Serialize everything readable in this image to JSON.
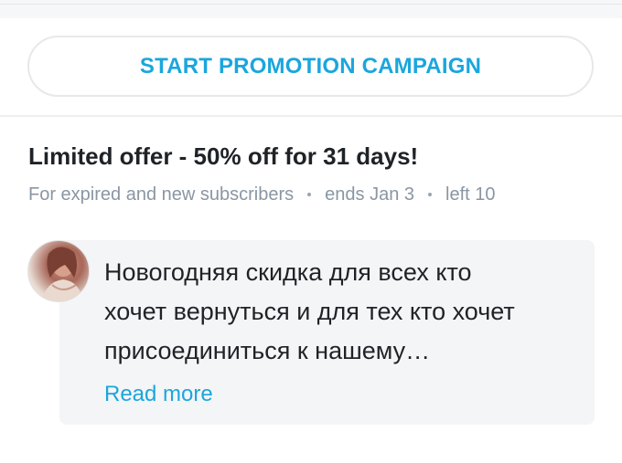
{
  "promo_button": {
    "label": "START PROMOTION CAMPAIGN"
  },
  "offer": {
    "title": "Limited offer - 50% off for 31 days!",
    "audience": "For expired and new subscribers",
    "ends": "ends Jan 3",
    "left": "left 10"
  },
  "message": {
    "avatar_icon": "user-avatar",
    "lines": [
      "Новогодняя скидка для всех кто",
      "хочет вернуться и для тех кто хочет",
      "присоединиться к нашему…"
    ],
    "read_more": "Read more"
  },
  "colors": {
    "accent": "#1aa6dd",
    "text_primary": "#1f2327",
    "text_muted": "#8a96a3",
    "bubble_bg": "#f4f5f7"
  }
}
